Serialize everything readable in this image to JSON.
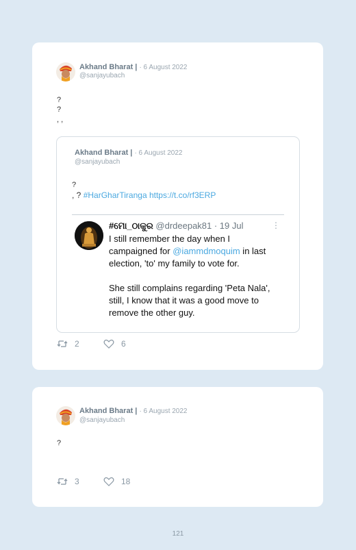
{
  "posts": [
    {
      "author": "Akhand Bharat |",
      "date": "· 6 August 2022",
      "handle": "@sanjayubach",
      "lines": [
        "?",
        "?",
        ", ,"
      ],
      "quote": {
        "author": "Akhand Bharat |",
        "date": "· 6 August 2022",
        "handle": "@sanjayubach",
        "line1": "?",
        "line2_prefix": ", ?",
        "hashtag": "#HarGharTiranga",
        "url": "https://t.co/rf3ERP",
        "embed": {
          "name": "#ମୋ_ଠାକୁର",
          "meta": "@drdeepak81 · 19 Jul",
          "dots": "⋮",
          "line1": "I still remember the day when I",
          "line2_prefix": "campaigned for ",
          "mention": "@iammdmoquim",
          "line2_suffix": " in last",
          "line3": "election, 'to' my family to vote for.",
          "line4": "She still complains regarding 'Peta Nala',",
          "line5": "still, I know that it was a good move to",
          "line6": "remove the other guy."
        }
      },
      "retweets": "2",
      "likes": "6"
    },
    {
      "author": "Akhand Bharat |",
      "date": "· 6 August 2022",
      "handle": "@sanjayubach",
      "lines": [
        "?"
      ],
      "retweets": "3",
      "likes": "18"
    }
  ],
  "page_number": "121",
  "colors": {
    "link": "#4aa8e0",
    "background": "#dde9f3",
    "card": "#ffffff"
  },
  "icons": [
    "retweet-icon",
    "heart-icon"
  ]
}
